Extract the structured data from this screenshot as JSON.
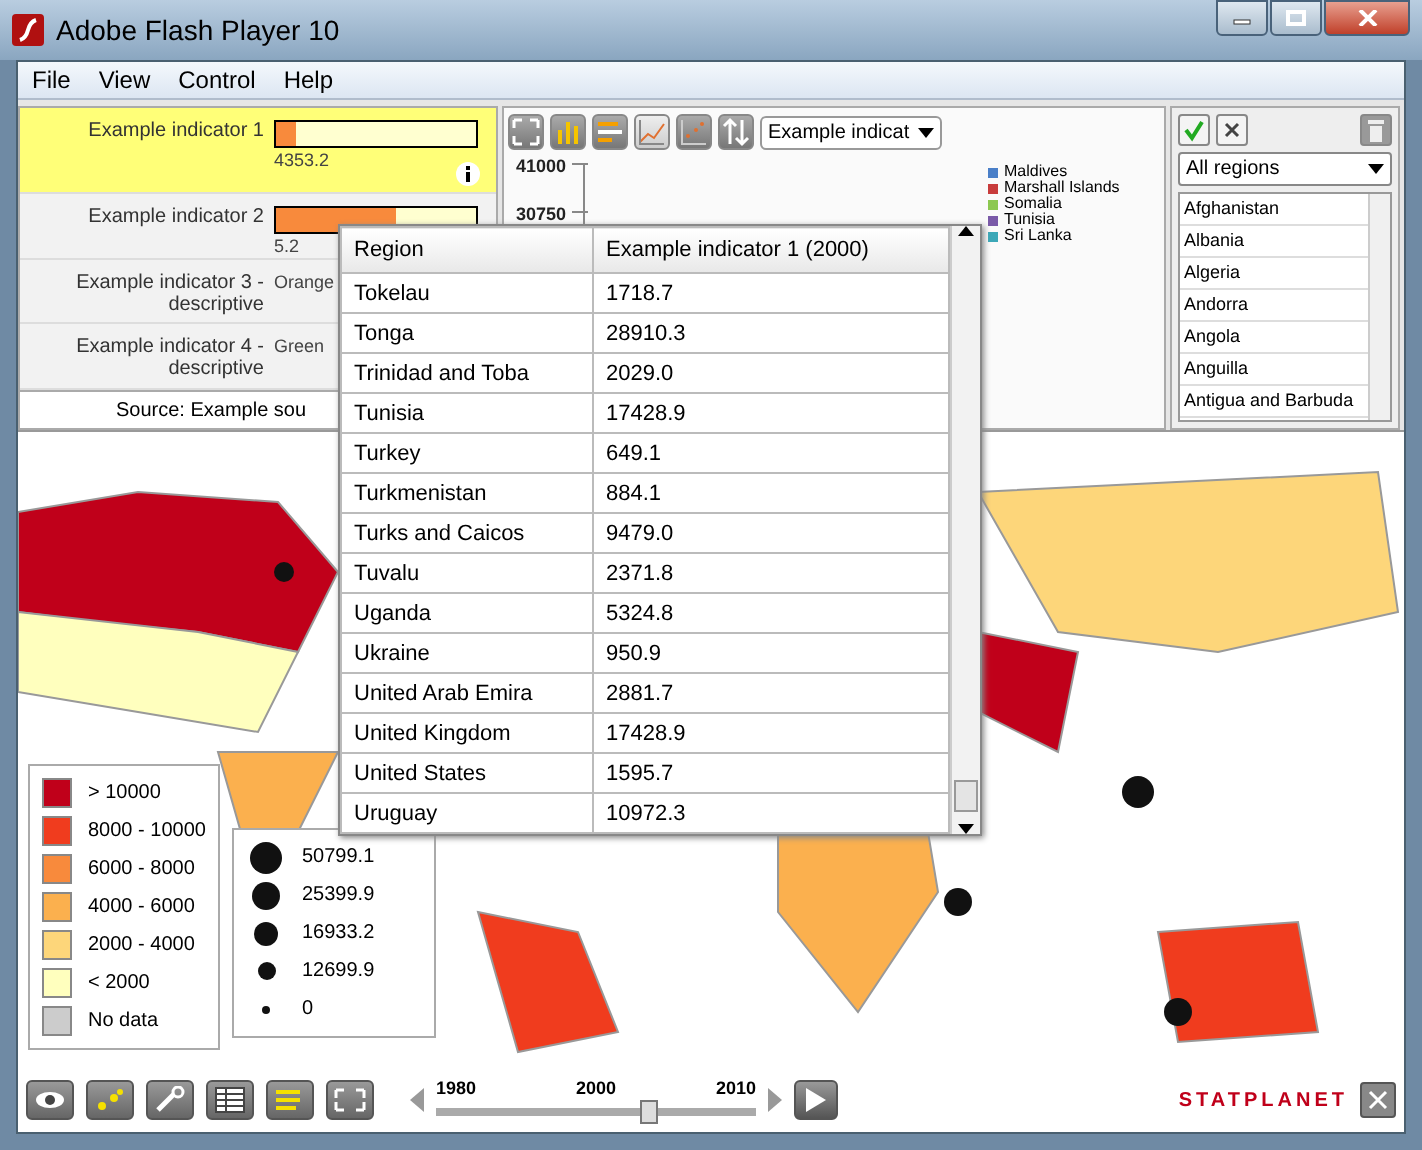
{
  "window": {
    "title": "Adobe Flash Player 10"
  },
  "menu": [
    "File",
    "View",
    "Control",
    "Help"
  ],
  "indicators": [
    {
      "kind": "bar",
      "label": "Example indicator 1",
      "value": "4353.2",
      "level": 0.1,
      "selected": true
    },
    {
      "kind": "bar",
      "label": "Example indicator 2",
      "value": "5.2",
      "level": 0.6,
      "selected": false
    },
    {
      "kind": "text",
      "label": "Example indicator 3 - descriptive",
      "value": "Orange",
      "selected": false
    },
    {
      "kind": "text",
      "label": "Example indicator 4 - descriptive",
      "value": "Green",
      "selected": false
    }
  ],
  "source": "Source: Example sou",
  "chart_toolbar": {
    "tools": [
      {
        "kind": "expand",
        "selected": false
      },
      {
        "kind": "bars",
        "selected": false
      },
      {
        "kind": "hbars",
        "selected": false
      },
      {
        "kind": "line",
        "selected": true
      },
      {
        "kind": "scatter",
        "selected": false
      },
      {
        "kind": "sort",
        "selected": false
      }
    ],
    "indicator_select": "Example indicat"
  },
  "chart": {
    "y_labels": [
      "41000",
      "30750"
    ],
    "legend": [
      {
        "label": "Maldives",
        "color": "#4a7fc8"
      },
      {
        "label": "Marshall Islands",
        "color": "#c83c3c"
      },
      {
        "label": "Somalia",
        "color": "#8cc850"
      },
      {
        "label": "Tunisia",
        "color": "#7a5aa8"
      },
      {
        "label": "Sri Lanka",
        "color": "#3ca8b8"
      }
    ]
  },
  "region_panel": {
    "filter": "All regions",
    "regions": [
      "Afghanistan",
      "Albania",
      "Algeria",
      "Andorra",
      "Angola",
      "Anguilla",
      "Antigua and Barbuda"
    ]
  },
  "table": {
    "columns": [
      "Region",
      "Example indicator 1 (2000)"
    ],
    "rows": [
      [
        "Tokelau",
        "1718.7"
      ],
      [
        "Tonga",
        "28910.3"
      ],
      [
        "Trinidad and Toba",
        "2029.0"
      ],
      [
        "Tunisia",
        "17428.9"
      ],
      [
        "Turkey",
        "649.1"
      ],
      [
        "Turkmenistan",
        "884.1"
      ],
      [
        "Turks and Caicos",
        "9479.0"
      ],
      [
        "Tuvalu",
        "2371.8"
      ],
      [
        "Uganda",
        "5324.8"
      ],
      [
        "Ukraine",
        "950.9"
      ],
      [
        "United Arab Emira",
        "2881.7"
      ],
      [
        "United Kingdom",
        "17428.9"
      ],
      [
        "United States",
        "1595.7"
      ],
      [
        "Uruguay",
        "10972.3"
      ]
    ]
  },
  "color_legend": [
    {
      "label": "> 10000",
      "color": "#c0001a"
    },
    {
      "label": "8000 - 10000",
      "color": "#f03c1e"
    },
    {
      "label": "6000 - 8000",
      "color": "#f88a3c"
    },
    {
      "label": "4000 - 6000",
      "color": "#fbb04e"
    },
    {
      "label": "2000 - 4000",
      "color": "#fdd67a"
    },
    {
      "label": "< 2000",
      "color": "#ffffbe"
    },
    {
      "label": "No data",
      "color": "#cccccc"
    }
  ],
  "size_legend": [
    "50799.1",
    "25399.9",
    "16933.2",
    "12699.9",
    "0"
  ],
  "bottom_tools": [
    {
      "kind": "eye"
    },
    {
      "kind": "dots"
    },
    {
      "kind": "wrench"
    },
    {
      "kind": "table"
    },
    {
      "kind": "list"
    },
    {
      "kind": "expand"
    }
  ],
  "timeline": {
    "start": "1980",
    "current": "2000",
    "end": "2010",
    "level": 0.66
  },
  "logo": "STATPLANET"
}
